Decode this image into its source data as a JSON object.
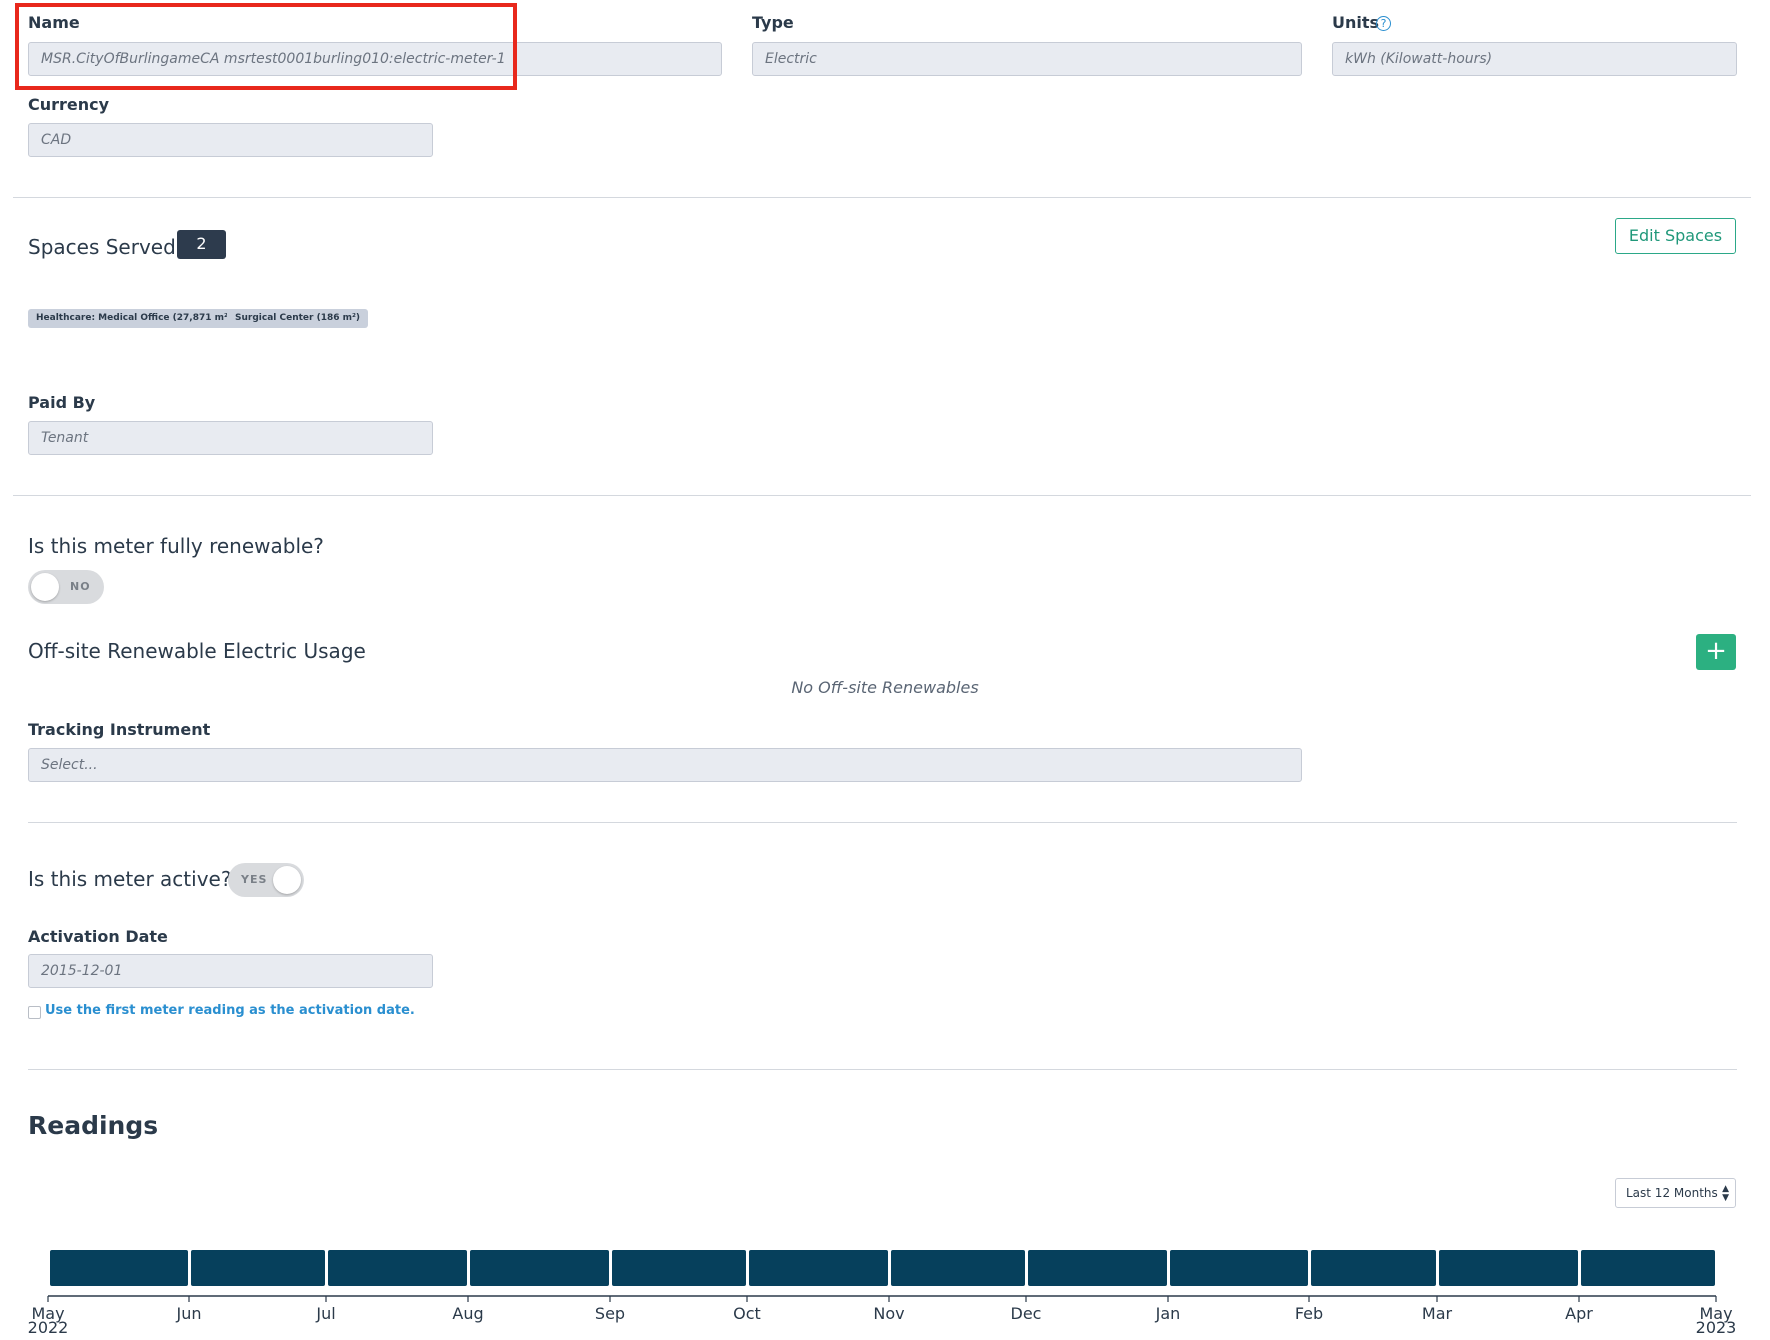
{
  "fields": {
    "name": {
      "label": "Name",
      "value": "MSR.CityOfBurlingameCA msrtest0001burling010:electric-meter-1"
    },
    "type": {
      "label": "Type",
      "value": "Electric"
    },
    "units": {
      "label": "Units",
      "value": "kWh (Kilowatt-hours)"
    },
    "currency": {
      "label": "Currency",
      "value": "CAD"
    },
    "paid_by": {
      "label": "Paid By",
      "value": "Tenant"
    }
  },
  "spaces": {
    "heading": "Spaces Served:",
    "count": "2",
    "edit_label": "Edit Spaces",
    "tags": [
      "Healthcare: Medical Office (27,871 m²)",
      "Surgical Center (186 m²)"
    ]
  },
  "renewable": {
    "question": "Is this meter fully renewable?",
    "toggle_text": "NO",
    "offsite_heading": "Off-site Renewable Electric Usage",
    "add_label": "+",
    "empty_text": "No Off-site Renewables",
    "tracking_label": "Tracking Instrument",
    "tracking_placeholder": "Select..."
  },
  "active": {
    "question": "Is this meter active?",
    "toggle_text": "YES",
    "activation_label": "Activation Date",
    "activation_value": "2015-12-01",
    "checkbox_label": "Use the first meter reading as the activation date."
  },
  "readings": {
    "heading": "Readings",
    "range_select": "Last 12 Months"
  },
  "icons": {
    "help": "help-icon"
  },
  "colors": {
    "accent": "#2cb081",
    "bar": "#06405c",
    "highlight": "#e8281c",
    "link": "#2a8fd0"
  },
  "chart_data": {
    "type": "bar",
    "categories": [
      "May 2022",
      "Jun",
      "Jul",
      "Aug",
      "Sep",
      "Oct",
      "Nov",
      "Dec",
      "Jan",
      "Feb",
      "Mar",
      "Apr",
      "May 2023"
    ],
    "tick_labels": [
      [
        "May",
        "2022"
      ],
      [
        "Jun"
      ],
      [
        "Jul"
      ],
      [
        "Aug"
      ],
      [
        "Sep"
      ],
      [
        "Oct"
      ],
      [
        "Nov"
      ],
      [
        "Dec"
      ],
      [
        "Jan"
      ],
      [
        "Feb"
      ],
      [
        "Mar"
      ],
      [
        "Apr"
      ],
      [
        "May",
        "2023"
      ]
    ],
    "x": [
      "2022-05-01",
      "2022-06-01",
      "2022-07-01",
      "2022-08-01",
      "2022-09-01",
      "2022-10-01",
      "2022-11-01",
      "2022-12-01",
      "2023-01-01",
      "2023-02-01",
      "2023-03-01",
      "2023-04-01",
      "2023-05-01"
    ],
    "bars": [
      {
        "start": "2022-05-01",
        "end": "2022-06-01"
      },
      {
        "start": "2022-06-01",
        "end": "2022-07-01"
      },
      {
        "start": "2022-07-01",
        "end": "2022-08-01"
      },
      {
        "start": "2022-08-01",
        "end": "2022-09-01"
      },
      {
        "start": "2022-09-01",
        "end": "2022-10-01"
      },
      {
        "start": "2022-10-01",
        "end": "2022-11-01"
      },
      {
        "start": "2022-11-01",
        "end": "2022-12-01"
      },
      {
        "start": "2022-12-01",
        "end": "2023-01-01"
      },
      {
        "start": "2023-01-01",
        "end": "2023-02-01"
      },
      {
        "start": "2023-02-01",
        "end": "2023-03-01"
      },
      {
        "start": "2023-03-01",
        "end": "2023-04-01"
      },
      {
        "start": "2023-04-01",
        "end": "2023-05-01"
      }
    ],
    "title": "",
    "xlabel": "",
    "ylabel": ""
  }
}
